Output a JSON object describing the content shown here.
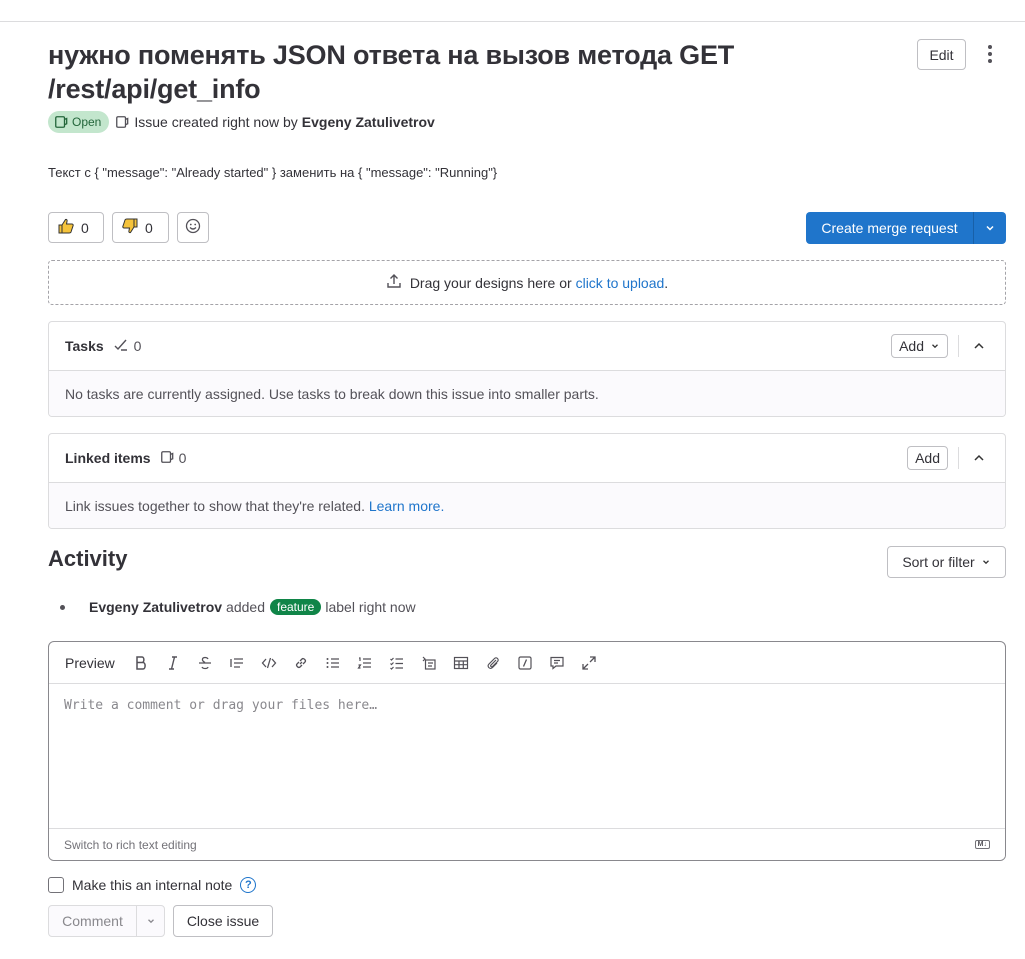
{
  "issue": {
    "title": "нужно поменять JSON ответа на вызов метода GET /rest/api/get_info",
    "status": "Open",
    "meta_prefix": "Issue created right now by",
    "author": "Evgeny Zatulivetrov",
    "description": "Текст с { \"message\": \"Already started\" } заменить на { \"message\": \"Running\"}",
    "edit_label": "Edit"
  },
  "reactions": {
    "thumbs_up_count": "0",
    "thumbs_down_count": "0"
  },
  "merge_request": {
    "label": "Create merge request"
  },
  "upload": {
    "text": "Drag your designs here or",
    "link": "click to upload",
    "suffix": "."
  },
  "tasks": {
    "title": "Tasks",
    "count": "0",
    "add_label": "Add",
    "empty_text": "No tasks are currently assigned. Use tasks to break down this issue into smaller parts."
  },
  "linked": {
    "title": "Linked items",
    "count": "0",
    "add_label": "Add",
    "empty_text": "Link issues together to show that they're related.",
    "learn_more": "Learn more."
  },
  "activity": {
    "title": "Activity",
    "sort_label": "Sort or filter",
    "note_author": "Evgeny Zatulivetrov",
    "note_action": "added",
    "note_label": "feature",
    "note_suffix": "label right now"
  },
  "editor": {
    "preview_label": "Preview",
    "placeholder": "Write a comment or drag your files here…",
    "switch_label": "Switch to rich text editing",
    "md_badge": "M↓"
  },
  "form": {
    "internal_note_label": "Make this an internal note",
    "comment_label": "Comment",
    "close_label": "Close issue"
  },
  "colors": {
    "primary": "#1f75cb",
    "open_badge_bg": "#c3e6cd",
    "feature_label": "#108548"
  }
}
